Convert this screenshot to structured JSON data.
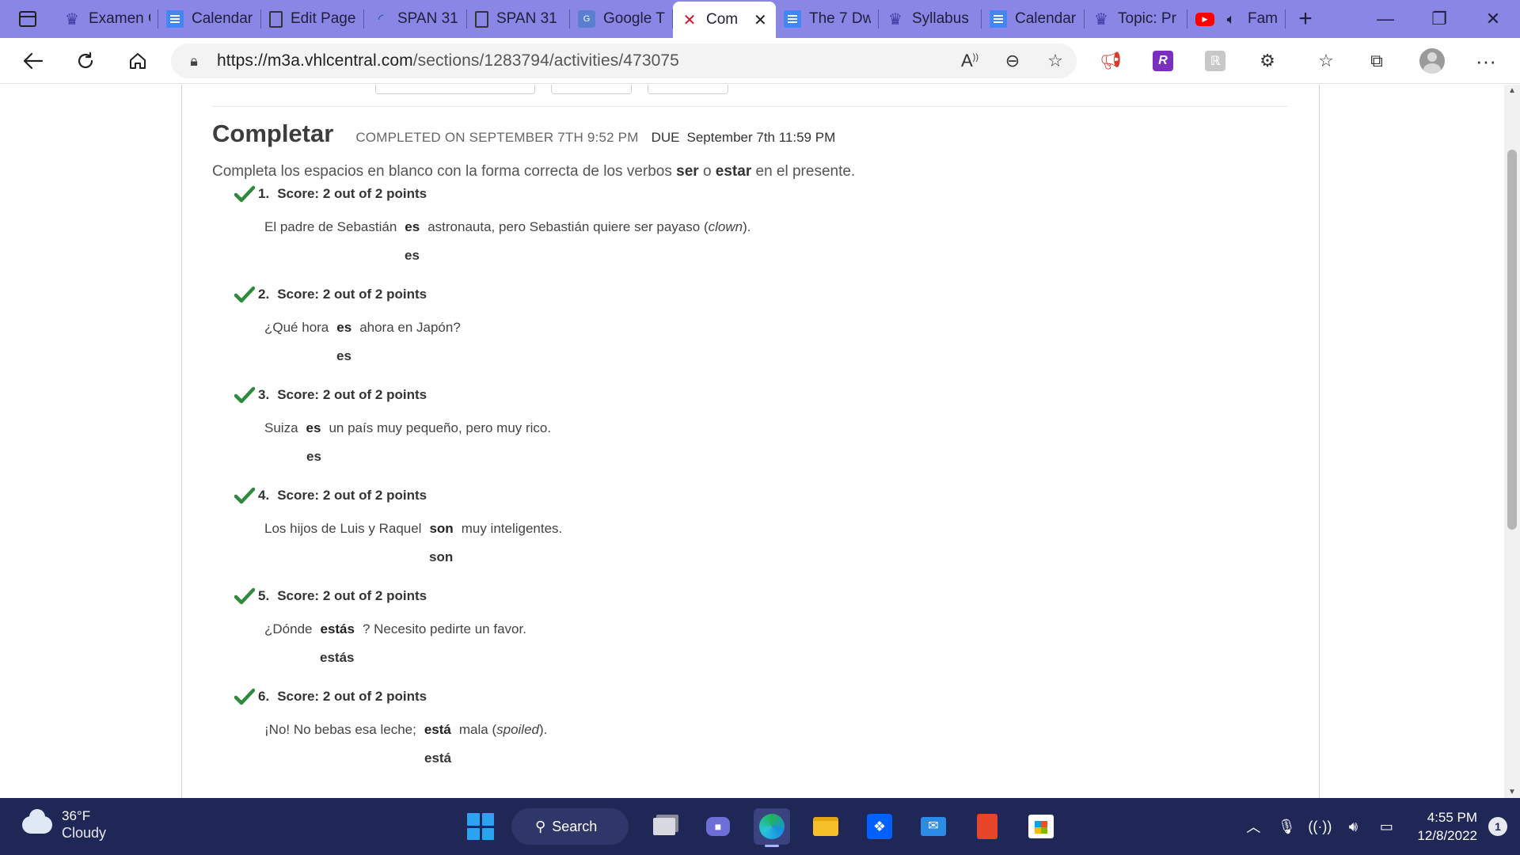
{
  "browser": {
    "tabs": [
      {
        "label": "Examen C",
        "icon": "crown-icon"
      },
      {
        "label": "Calendar",
        "icon": "docs-icon"
      },
      {
        "label": "Edit Page",
        "icon": "page-icon"
      },
      {
        "label": "SPAN 31",
        "icon": "loading-icon"
      },
      {
        "label": "SPAN 31",
        "icon": "page-icon"
      },
      {
        "label": "Google T",
        "icon": "translate-icon"
      },
      {
        "label": "Com",
        "icon": "vhl-icon",
        "active": true
      },
      {
        "label": "The 7 Dw",
        "icon": "docs-icon"
      },
      {
        "label": "Syllabus",
        "icon": "crown-icon"
      },
      {
        "label": "Calendar",
        "icon": "docs-icon"
      },
      {
        "label": "Topic: Pr",
        "icon": "crown-icon"
      },
      {
        "label": "Fam",
        "icon": "youtube-icon",
        "audio": true
      }
    ],
    "url_domain": "https://m3a.vhlcentral.com",
    "url_path": "/sections/1283794/activities/473075"
  },
  "page": {
    "title": "Completar",
    "completed": "COMPLETED ON SEPTEMBER 7TH 9:52 PM",
    "due_label": "DUE",
    "due_date": "September 7th 11:59 PM",
    "instructions": {
      "pre": "Completa los espacios en blanco con la forma correcta de los verbos ",
      "verb1": "ser",
      "mid": " o ",
      "verb2": "estar",
      "post": " en el presente."
    },
    "questions": [
      {
        "num": "1.",
        "score": "Score: 2 out of 2 points",
        "before": "El padre de Sebastián",
        "answer": "es",
        "after": "astronauta, pero Sebastián quiere ser payaso (",
        "italic": "clown",
        "after2": ").",
        "correct": "es"
      },
      {
        "num": "2.",
        "score": "Score: 2 out of 2 points",
        "before": "¿Qué hora",
        "answer": "es",
        "after": "ahora en Japón?",
        "italic": "",
        "after2": "",
        "correct": "es"
      },
      {
        "num": "3.",
        "score": "Score: 2 out of 2 points",
        "before": "Suiza",
        "answer": "es",
        "after": "un país muy pequeño, pero muy rico.",
        "italic": "",
        "after2": "",
        "correct": "es"
      },
      {
        "num": "4.",
        "score": "Score: 2 out of 2 points",
        "before": "Los hijos de Luis y Raquel",
        "answer": "son",
        "after": "muy inteligentes.",
        "italic": "",
        "after2": "",
        "correct": "son"
      },
      {
        "num": "5.",
        "score": "Score: 2 out of 2 points",
        "before": "¿Dónde",
        "answer": "estás",
        "after": "? Necesito pedirte un favor.",
        "italic": "",
        "after2": "",
        "correct": "estás"
      },
      {
        "num": "6.",
        "score": "Score: 2 out of 2 points",
        "before": "¡No! No bebas esa leche;",
        "answer": "está",
        "after": "mala (",
        "italic": "spoiled",
        "after2": ").",
        "correct": "está"
      }
    ]
  },
  "taskbar": {
    "temp": "36°F",
    "weather": "Cloudy",
    "search_label": "Search",
    "time": "4:55 PM",
    "date": "12/8/2022",
    "notifications": "1"
  },
  "colors": {
    "tabbar": "#8a86e6",
    "taskbar": "#1f2757",
    "check": "#2e8b3e"
  }
}
